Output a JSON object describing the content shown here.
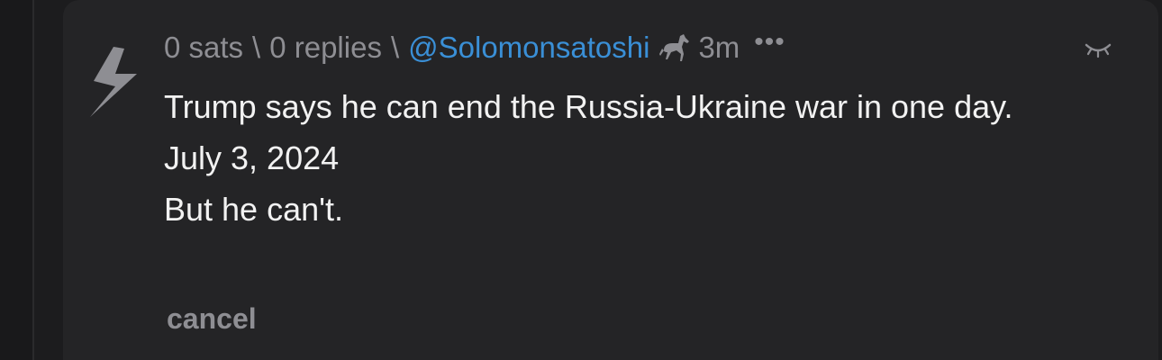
{
  "item": {
    "sats": "0 sats",
    "separator": "\\",
    "replies": "0 replies",
    "user": "@Solomonsatoshi",
    "time": "3m",
    "more": "•••",
    "body_lines": [
      "Trump says he can end the Russia-Ukraine war in one day.",
      "July 3, 2024",
      "But he can't."
    ],
    "cancel_label": "cancel"
  },
  "icons": {
    "bolt": "lightning-bolt-icon",
    "horse": "horse-icon",
    "eye": "eye-closed-icon",
    "more": "more-icon"
  },
  "colors": {
    "background": "#1c1c1e",
    "card": "#242426",
    "text": "#f2f2f2",
    "muted": "#8e8e93",
    "link": "#3a8fd6"
  }
}
